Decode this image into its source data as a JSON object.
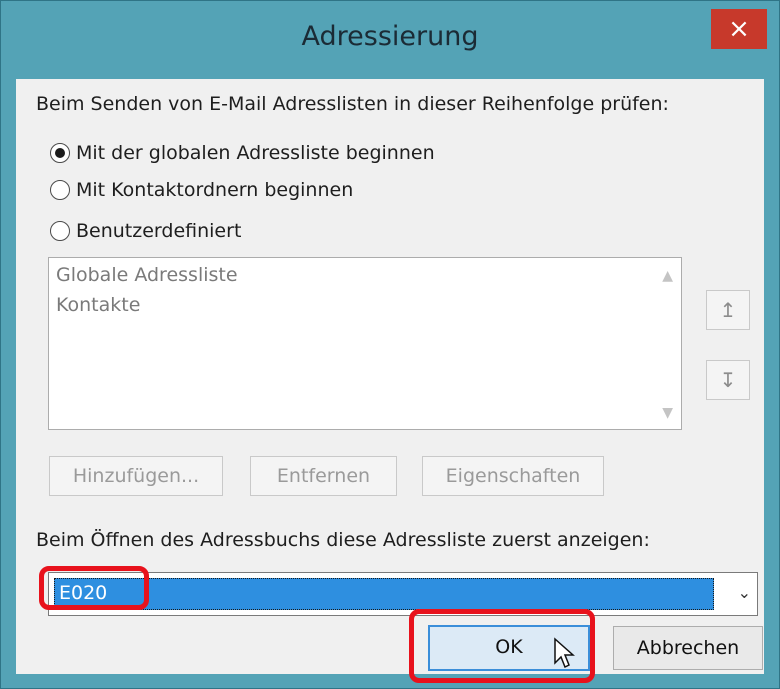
{
  "window": {
    "title": "Adressierung",
    "close_glyph": "×"
  },
  "instruction": "Beim Senden von E-Mail Adresslisten in dieser Reihenfolge prüfen:",
  "radio_options": [
    {
      "label": "Mit der globalen Adressliste beginnen",
      "checked": true
    },
    {
      "label": "Mit Kontaktordnern beginnen",
      "checked": false
    },
    {
      "label": "Benutzerdefiniert",
      "checked": false
    }
  ],
  "address_list": {
    "items": [
      "Globale Adressliste",
      "Kontakte"
    ]
  },
  "move_up_glyph": "↥",
  "move_down_glyph": "↧",
  "buttons": {
    "add": "Hinzufügen...",
    "remove": "Entfernen",
    "properties": "Eigenschaften",
    "ok": "OK",
    "cancel": "Abbrechen"
  },
  "open_label": "Beim Öffnen des Adressbuchs diese Adressliste zuerst anzeigen:",
  "combo": {
    "value": "E020",
    "arrow_glyph": "⌄"
  },
  "colors": {
    "highlight": "#e8121c",
    "selection": "#2e8fe0",
    "titlebar": "#54a3b6",
    "close": "#c7392b"
  }
}
